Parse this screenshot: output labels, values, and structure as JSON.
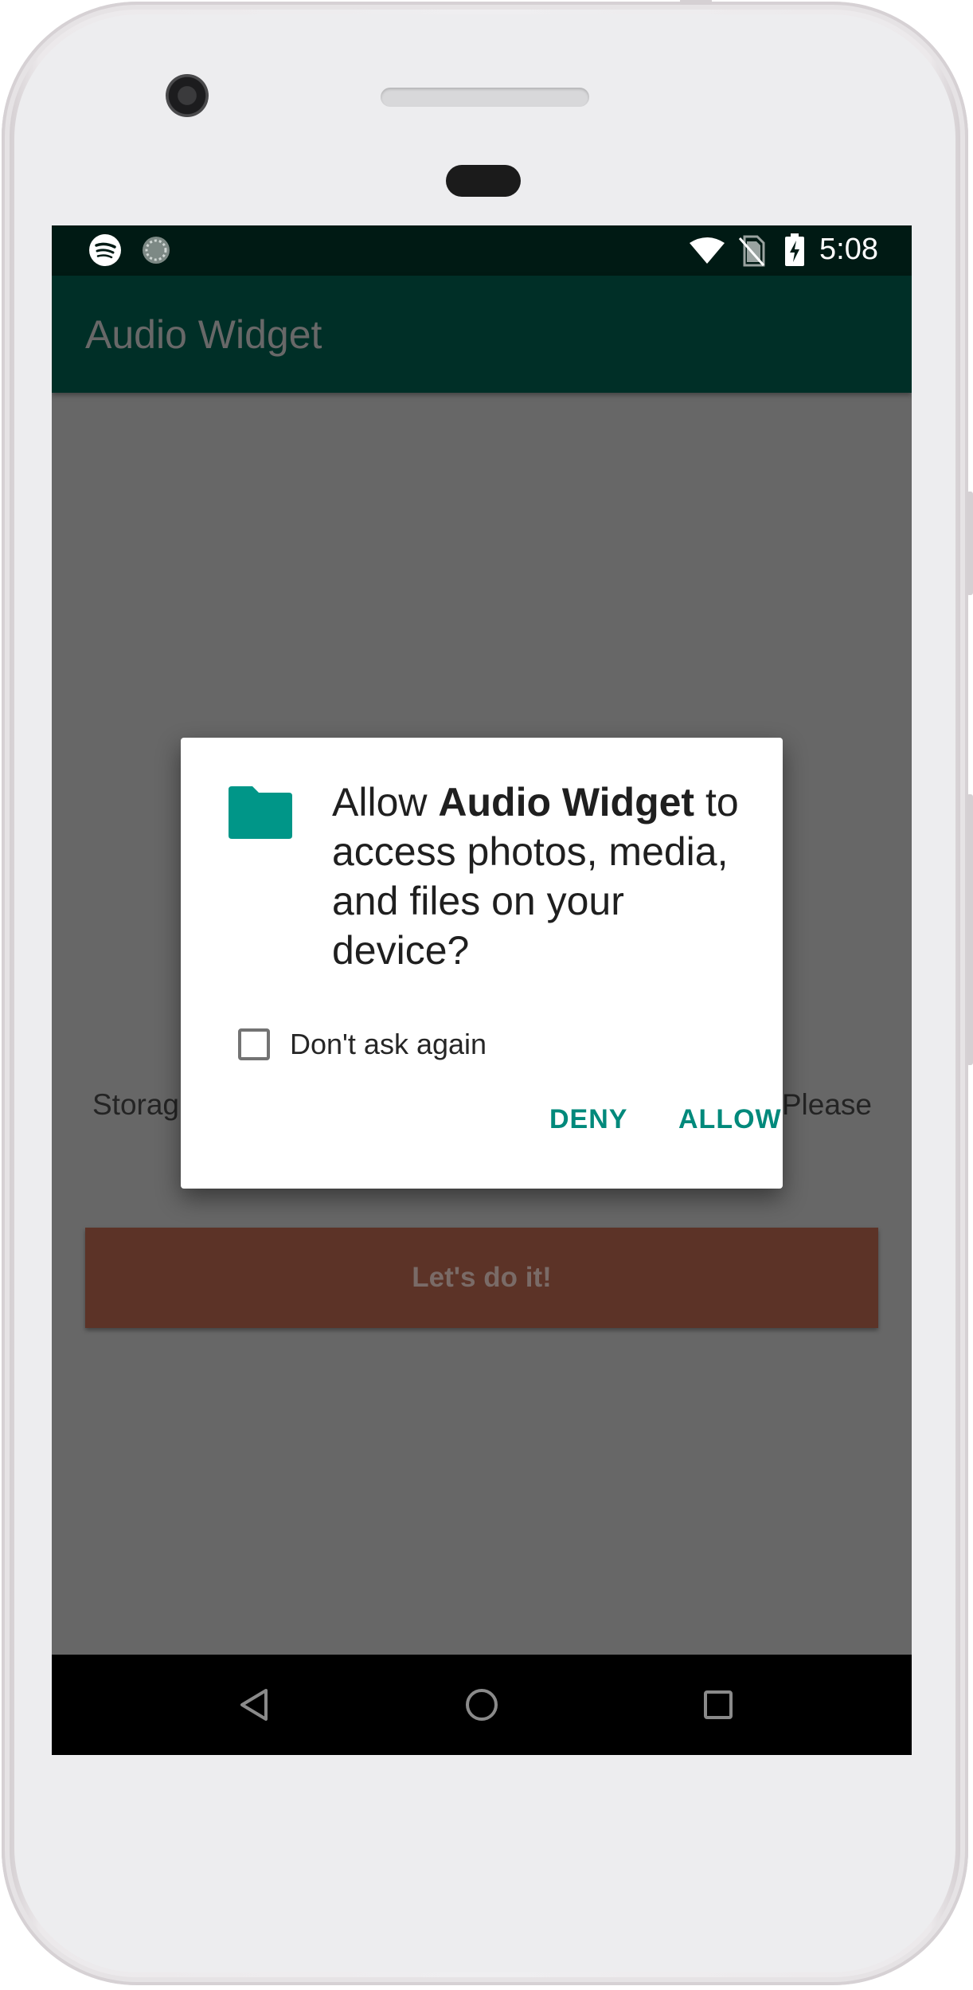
{
  "status_bar": {
    "time": "5:08",
    "left_icons": [
      "spotify-icon",
      "loading-circle-icon"
    ],
    "right_icons": [
      "wifi-icon",
      "no-sim-icon",
      "battery-charging-icon"
    ]
  },
  "app_bar": {
    "title": "Audio Widget"
  },
  "background_content": {
    "text_left_fragment": "Storag",
    "text_right_fragment": "Please",
    "button_label": "Let's do it!"
  },
  "dialog": {
    "icon": "folder-icon",
    "message_prefix": "Allow ",
    "message_app": "Audio Widget",
    "message_suffix": " to access photos, media, and files on your device?",
    "checkbox_label": "Don't ask again",
    "checkbox_checked": false,
    "deny_label": "DENY",
    "allow_label": "ALLOW"
  },
  "nav_bar": {
    "buttons": [
      "back-icon",
      "home-icon",
      "recents-icon"
    ]
  },
  "colors": {
    "status_bar": "#001a14",
    "app_bar": "#002f27",
    "scrim_background": "#676767",
    "accent": "#00897b",
    "action_button": "#5c3327"
  }
}
